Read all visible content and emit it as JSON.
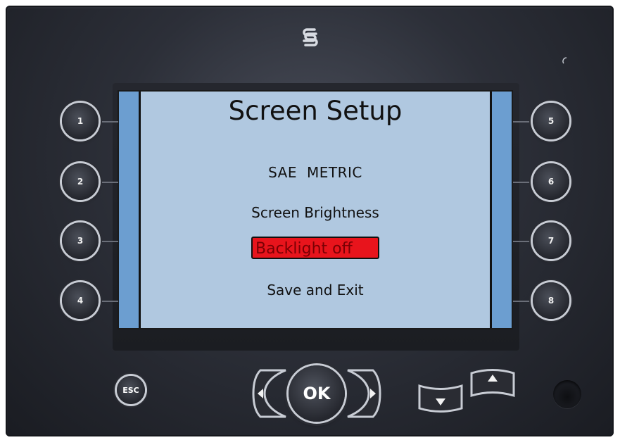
{
  "screen": {
    "title": "Screen Setup",
    "menu": {
      "unit_sae": "SAE",
      "unit_metric": "METRIC",
      "brightness": "Screen Brightness",
      "backlight": "Backlight off",
      "save_exit": "Save and Exit"
    },
    "selected_item": "Backlight off",
    "colors": {
      "background": "#b0c8e0",
      "sidebar": "#6c9ed0",
      "highlight": "#e8141c"
    }
  },
  "side_buttons": {
    "left": [
      "1",
      "2",
      "3",
      "4"
    ],
    "right": [
      "5",
      "6",
      "7",
      "8"
    ]
  },
  "bottom_controls": {
    "esc_label": "ESC",
    "ok_label": "OK",
    "left_arrow_icon": "arrow-left-icon",
    "right_arrow_icon": "arrow-right-icon",
    "down_arrow_icon": "arrow-down-icon",
    "up_arrow_icon": "arrow-up-icon"
  },
  "branding": {
    "logo_icon": "s-logo-icon"
  }
}
